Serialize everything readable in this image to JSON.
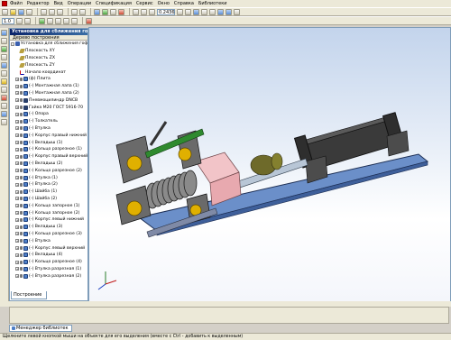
{
  "menu": {
    "items": [
      "Файл",
      "Редактор",
      "Вид",
      "Операции",
      "Спецификация",
      "Сервис",
      "Окно",
      "Справка",
      "Библиотеки"
    ]
  },
  "toolbar": {
    "zoom_value": "0.2436",
    "scale_value": "1.0"
  },
  "panel": {
    "title": "Установка для сближения гофр",
    "subtitle": "Дерево построения",
    "tab_label": "Построение",
    "tree": [
      {
        "label": "Установка для сближения гофр",
        "icon": "asm",
        "level": 0,
        "exp": "-"
      },
      {
        "label": "Плоскость XY",
        "icon": "plane",
        "level": 1,
        "exp": ""
      },
      {
        "label": "Плоскость ZX",
        "icon": "plane",
        "level": 1,
        "exp": ""
      },
      {
        "label": "Плоскость ZY",
        "icon": "plane",
        "level": 1,
        "exp": ""
      },
      {
        "label": "Начало координат",
        "icon": "axis",
        "level": 1,
        "exp": ""
      },
      {
        "label": "(ф) Плита",
        "icon": "part",
        "level": 1,
        "exp": "+"
      },
      {
        "label": "(-) Монтажная лапа (1)",
        "icon": "part",
        "level": 1,
        "exp": "+"
      },
      {
        "label": "(-) Монтажная лапа (2)",
        "icon": "part",
        "level": 1,
        "exp": "+"
      },
      {
        "label": "Пневмоцилиндр DNCB",
        "icon": "dark",
        "level": 1,
        "exp": "+"
      },
      {
        "label": "Гайка М20 ГОСТ 5916-70",
        "icon": "dark",
        "level": 1,
        "exp": "+"
      },
      {
        "label": "(-) Опора",
        "icon": "part",
        "level": 1,
        "exp": "+"
      },
      {
        "label": "(-) Толкатель",
        "icon": "part",
        "level": 1,
        "exp": "+"
      },
      {
        "label": "(-) Втулка",
        "icon": "part",
        "level": 1,
        "exp": "+"
      },
      {
        "label": "(-) Корпус правый нижний",
        "icon": "part",
        "level": 1,
        "exp": "+"
      },
      {
        "label": "(-) Вкладыш (1)",
        "icon": "part",
        "level": 1,
        "exp": "+"
      },
      {
        "label": "(-) Кольцо разрезное (1)",
        "icon": "part",
        "level": 1,
        "exp": "+"
      },
      {
        "label": "(-) Корпус правый верхний",
        "icon": "part",
        "level": 1,
        "exp": "+"
      },
      {
        "label": "(-) Вкладыш (2)",
        "icon": "part",
        "level": 1,
        "exp": "+"
      },
      {
        "label": "(-) Кольцо разрезное (2)",
        "icon": "part",
        "level": 1,
        "exp": "+"
      },
      {
        "label": "(-) Втулка (1)",
        "icon": "part",
        "level": 1,
        "exp": "+"
      },
      {
        "label": "(-) Втулка (2)",
        "icon": "part",
        "level": 1,
        "exp": "+"
      },
      {
        "label": "(-) Шайба (1)",
        "icon": "part",
        "level": 1,
        "exp": "+"
      },
      {
        "label": "(-) Шайба (2)",
        "icon": "part",
        "level": 1,
        "exp": "+"
      },
      {
        "label": "(-) Кольцо запорное (1)",
        "icon": "part",
        "level": 1,
        "exp": "+"
      },
      {
        "label": "(-) Кольцо запорное (2)",
        "icon": "part",
        "level": 1,
        "exp": "+"
      },
      {
        "label": "(-) Корпус левый нижний",
        "icon": "part",
        "level": 1,
        "exp": "+"
      },
      {
        "label": "(-) Вкладыш (3)",
        "icon": "part",
        "level": 1,
        "exp": "+"
      },
      {
        "label": "(-) Кольцо разрезное (3)",
        "icon": "part",
        "level": 1,
        "exp": "+"
      },
      {
        "label": "(-) Втулка",
        "icon": "part",
        "level": 1,
        "exp": "+"
      },
      {
        "label": "(-) Корпус левый верхний",
        "icon": "part",
        "level": 1,
        "exp": "+"
      },
      {
        "label": "(-) Вкладыш (4)",
        "icon": "part",
        "level": 1,
        "exp": "+"
      },
      {
        "label": "(-) Кольцо разрезное (4)",
        "icon": "part",
        "level": 1,
        "exp": "+"
      },
      {
        "label": "(-) Втулка разрезная (1)",
        "icon": "part",
        "level": 1,
        "exp": "+"
      },
      {
        "label": "(-) Втулка разрезная (2)",
        "icon": "part",
        "level": 1,
        "exp": "+"
      }
    ]
  },
  "library_tab": "Менеджер библиотек",
  "status": "Щелкните левой кнопкой мыши на объекте для его выделения (вместе с Ctrl - добавить к выделенным)",
  "colors": {
    "accent": "#0a246a",
    "model_gray": "#4a4a4a",
    "pink": "#f2c4c8",
    "green": "#2f8a2f"
  }
}
